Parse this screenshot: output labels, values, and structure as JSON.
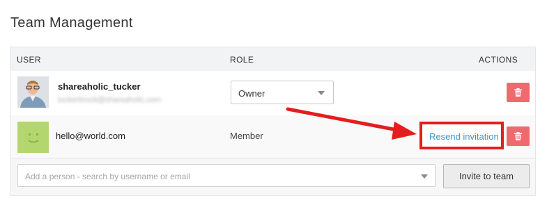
{
  "page": {
    "title": "Team Management"
  },
  "table": {
    "headers": {
      "user": "USER",
      "role": "ROLE",
      "actions": "ACTIONS"
    },
    "rows": [
      {
        "username": "shareaholic_tucker",
        "email": "tuckerbrock@shareaholic.com",
        "role": "Owner"
      },
      {
        "email": "hello@world.com",
        "role": "Member",
        "resend_label": "Resend invitation"
      }
    ]
  },
  "add_person": {
    "placeholder": "Add a person - search by username or email",
    "invite_label": "Invite to team"
  },
  "colors": {
    "delete": "#ee6a6f",
    "link": "#3a97d4",
    "highlight": "#e41e1e"
  },
  "icons": {
    "delete": "trash-icon",
    "dropdown": "chevron-down-icon"
  }
}
